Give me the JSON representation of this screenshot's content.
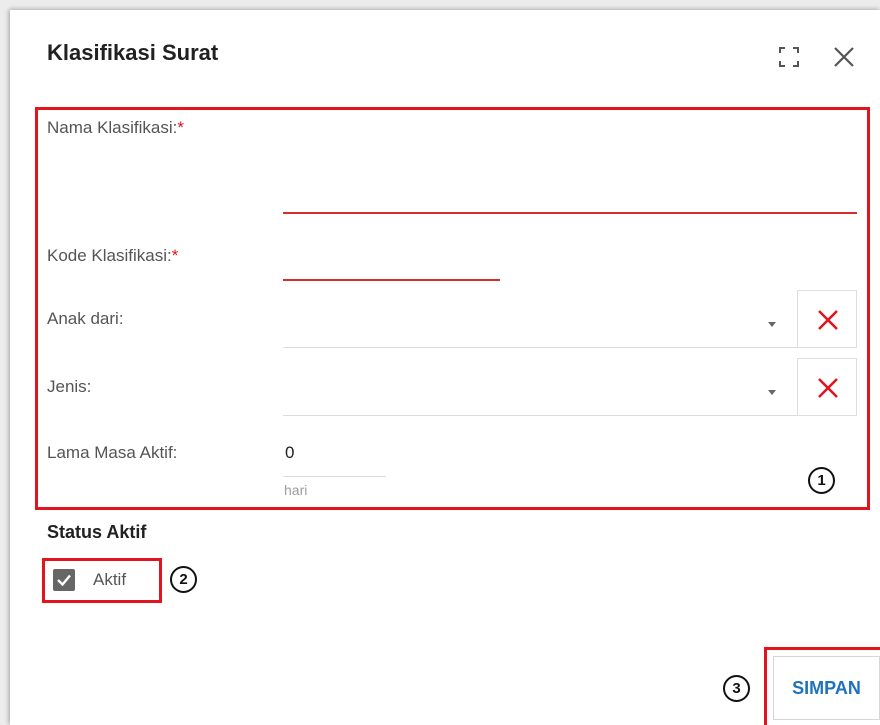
{
  "dialog": {
    "title": "Klasifikasi Surat",
    "icons": {
      "fullscreen": "fullscreen-icon",
      "close": "close-icon"
    }
  },
  "form": {
    "nama": {
      "label": "Nama Klasifikasi:",
      "required_mark": "*",
      "value": ""
    },
    "kode": {
      "label": "Kode Klasifikasi:",
      "required_mark": "*",
      "value": ""
    },
    "anak_dari": {
      "label": "Anak dari:",
      "selected": "",
      "clear_icon": "close-x-icon"
    },
    "jenis": {
      "label": "Jenis:",
      "selected": "",
      "clear_icon": "close-x-icon"
    },
    "lama_masa_aktif": {
      "label": "Lama Masa Aktif:",
      "value": "0",
      "unit_hint": "hari"
    }
  },
  "status": {
    "section_title": "Status Aktif",
    "checkbox_label": "Aktif",
    "checked": true
  },
  "actions": {
    "save_label": "SIMPAN"
  },
  "callouts": [
    "1",
    "2",
    "3"
  ],
  "colors": {
    "highlight": "#e2141d",
    "required_underline": "#d32f2f",
    "primary_text": "#1e73be",
    "checkbox": "#666666"
  }
}
